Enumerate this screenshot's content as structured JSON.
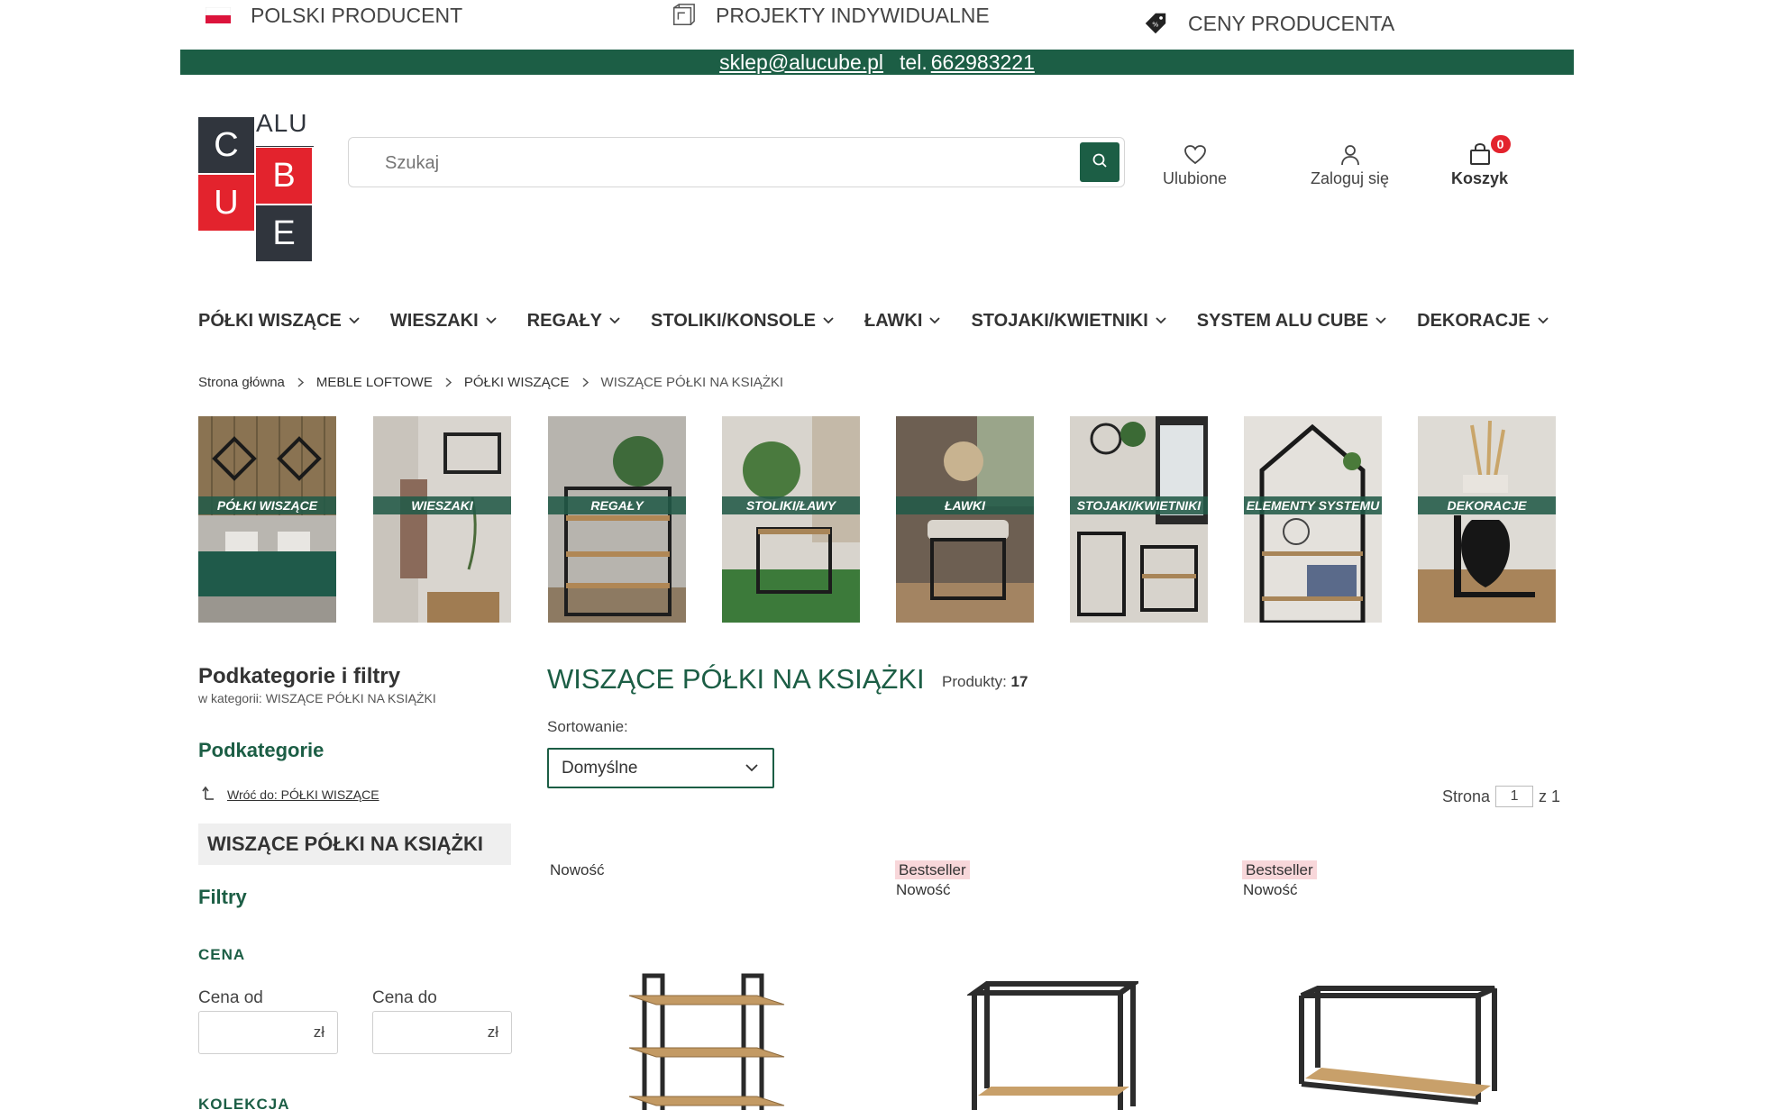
{
  "usp": [
    {
      "icon": "poland-flag-icon",
      "label": "POLSKI PRODUCENT"
    },
    {
      "icon": "blueprint-icon",
      "label": "PROJEKTY INDYWIDUALNE"
    },
    {
      "icon": "price-tag-icon",
      "label": "CENY PRODUCENTA"
    }
  ],
  "contact": {
    "email": "sklep@alucube.pl",
    "phone_prefix": "tel.",
    "phone": "662983221"
  },
  "logo": {
    "letters": [
      "C",
      "B",
      "U",
      "E"
    ],
    "top_text": "ALU"
  },
  "search": {
    "placeholder": "Szukaj",
    "button_icon": "search-icon"
  },
  "header_actions": {
    "favorites": "Ulubione",
    "login": "Zaloguj się",
    "cart": "Koszyk",
    "cart_count": "0"
  },
  "nav": [
    "PÓŁKI WISZĄCE",
    "WIESZAKI",
    "REGAŁY",
    "STOLIKI/KONSOLE",
    "ŁAWKI",
    "STOJAKI/KWIETNIKI",
    "SYSTEM ALU CUBE",
    "DEKORACJE"
  ],
  "breadcrumb": [
    "Strona główna",
    "MEBLE LOFTOWE",
    "PÓŁKI WISZĄCE",
    "WISZĄCE PÓŁKI NA KSIĄŻKI"
  ],
  "category_tiles": [
    "PÓŁKI WISZĄCE",
    "WIESZAKI",
    "REGAŁY",
    "STOLIKI/ŁAWY",
    "ŁAWKI",
    "STOJAKI/KWIETNIKI",
    "ELEMENTY SYSTEMU",
    "DEKORACJE"
  ],
  "sidebar": {
    "title": "Podkategorie i filtry",
    "subtitle": "w kategorii: WISZĄCE PÓŁKI NA KSIĄŻKI",
    "subcategories_heading": "Podkategorie",
    "back_link": "Wróć do: PÓŁKI WISZĄCE",
    "current_category": "WISZĄCE PÓŁKI NA KSIĄŻKI",
    "filters_heading": "Filtry",
    "price_heading": "CENA",
    "price_from_label": "Cena od",
    "price_to_label": "Cena do",
    "currency": "zł",
    "collection_heading": "KOLEKCJA"
  },
  "listing": {
    "title": "WISZĄCE PÓŁKI NA KSIĄŻKI",
    "count_label": "Produkty:",
    "count": "17",
    "sort_label": "Sortowanie:",
    "sort_value": "Domyślne",
    "page_label": "Strona",
    "page_current": "1",
    "page_of": "z 1"
  },
  "products": [
    {
      "badges": [
        "Nowość"
      ]
    },
    {
      "badges": [
        "Bestseller",
        "Nowość"
      ]
    },
    {
      "badges": [
        "Bestseller",
        "Nowość"
      ]
    }
  ],
  "colors": {
    "brand_green": "#1c5e45",
    "logo_dark": "#30353d",
    "logo_red": "#e3232d",
    "bestseller_bg": "#f8d7da"
  }
}
